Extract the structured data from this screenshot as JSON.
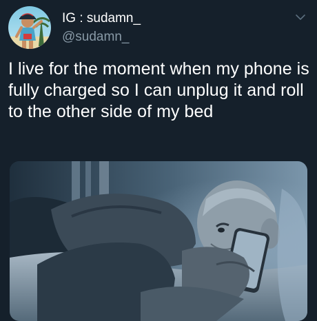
{
  "tweet": {
    "display_name": "IG : sudamn_",
    "handle": "@sudamn_",
    "text": "I live for the moment when my phone is fully charged so I can unplug it and roll to the other side of my bed"
  },
  "icons": {
    "avatar": "profile-avatar",
    "menu": "chevron-down-icon"
  },
  "colors": {
    "background": "#15202b",
    "primary_text": "#ffffff",
    "secondary_text": "#8899a6"
  }
}
